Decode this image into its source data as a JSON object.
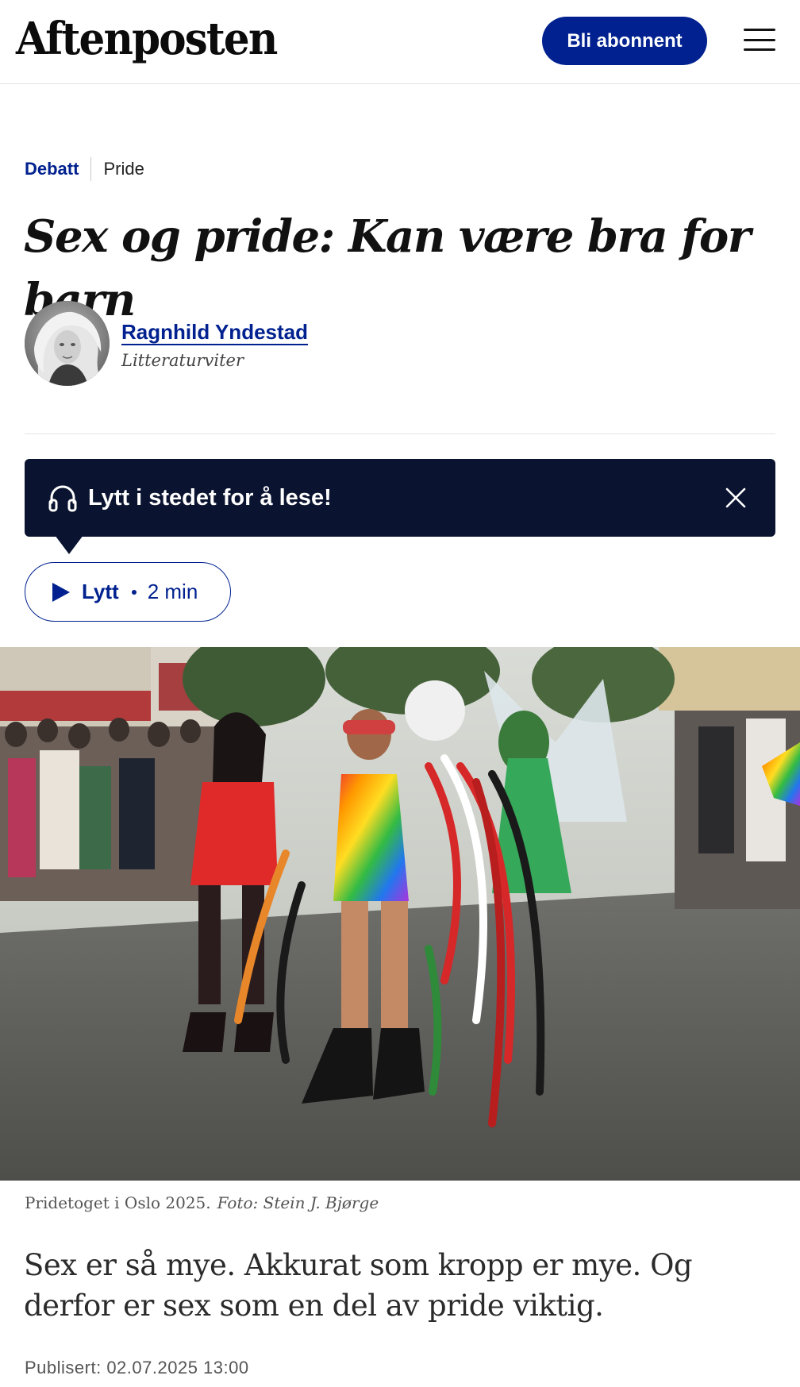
{
  "header": {
    "logo_text": "Aftenposten",
    "subscribe_label": "Bli abonnent"
  },
  "article": {
    "section": "Debatt",
    "subsection": "Pride",
    "title": "Sex og pride: Kan være bra for barn",
    "author": {
      "name": "Ragnhild Yndestad",
      "role": "Litteraturviter"
    },
    "listen_banner": {
      "text": "Lytt i stedet for å lese!"
    },
    "audio": {
      "play_label": "Lytt",
      "duration": "2 min"
    },
    "image": {
      "caption": "Pridetoget i Oslo 2025.",
      "credit": "Foto: Stein J. Bjørge"
    },
    "lead": "Sex er så mye. Akkurat som kropp er mye. Og derfor er sex som en del av pride viktig.",
    "published": "Publisert: 02.07.2025 13:00"
  },
  "colors": {
    "brand_blue": "#00218f",
    "banner_navy": "#0a1330"
  }
}
